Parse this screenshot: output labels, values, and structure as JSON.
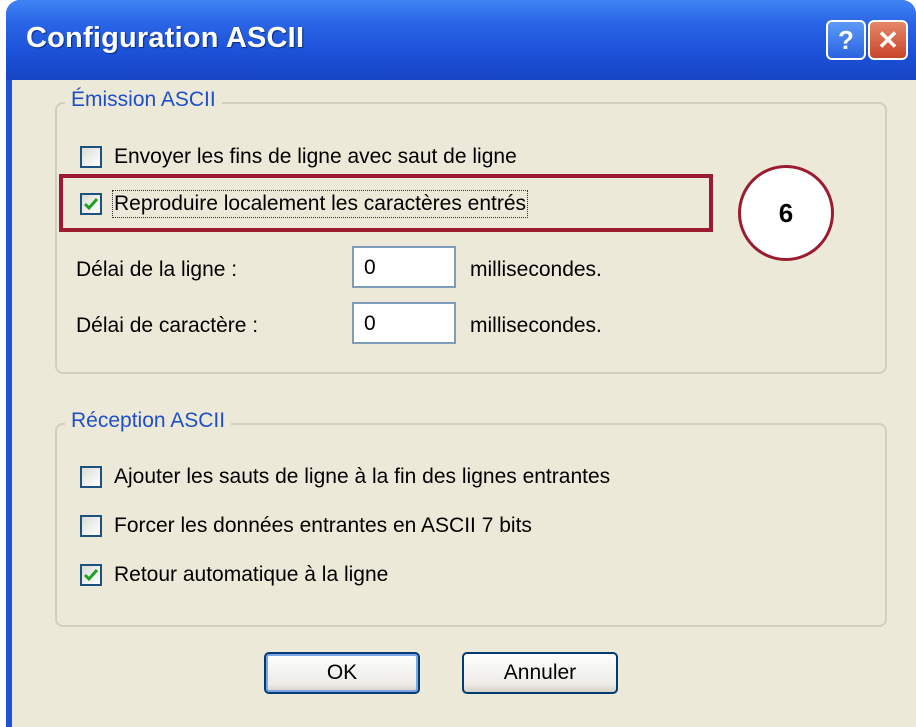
{
  "window": {
    "title": "Configuration ASCII"
  },
  "emission": {
    "legend": "Émission ASCII",
    "send_line_ends": {
      "label": "Envoyer les fins de ligne avec saut de ligne",
      "checked": false
    },
    "echo_local": {
      "label": "Reproduire localement les caractères entrés",
      "checked": true
    },
    "line_delay": {
      "label": "Délai de la ligne :",
      "value": "0",
      "unit": "millisecondes."
    },
    "char_delay": {
      "label": "Délai de caractère :",
      "value": "0",
      "unit": "millisecondes."
    }
  },
  "reception": {
    "legend": "Réception ASCII",
    "append_linefeeds": {
      "label": "Ajouter les sauts de ligne à la fin des lignes entrantes",
      "checked": false
    },
    "force_7bit": {
      "label": "Forcer les données entrantes en ASCII 7 bits",
      "checked": false
    },
    "wrap_lines": {
      "label": "Retour automatique à la ligne",
      "checked": true
    }
  },
  "buttons": {
    "ok": "OK",
    "cancel": "Annuler",
    "help": "?",
    "close": "✕"
  },
  "annotation": {
    "number": "6",
    "color": "#9b1b30"
  }
}
